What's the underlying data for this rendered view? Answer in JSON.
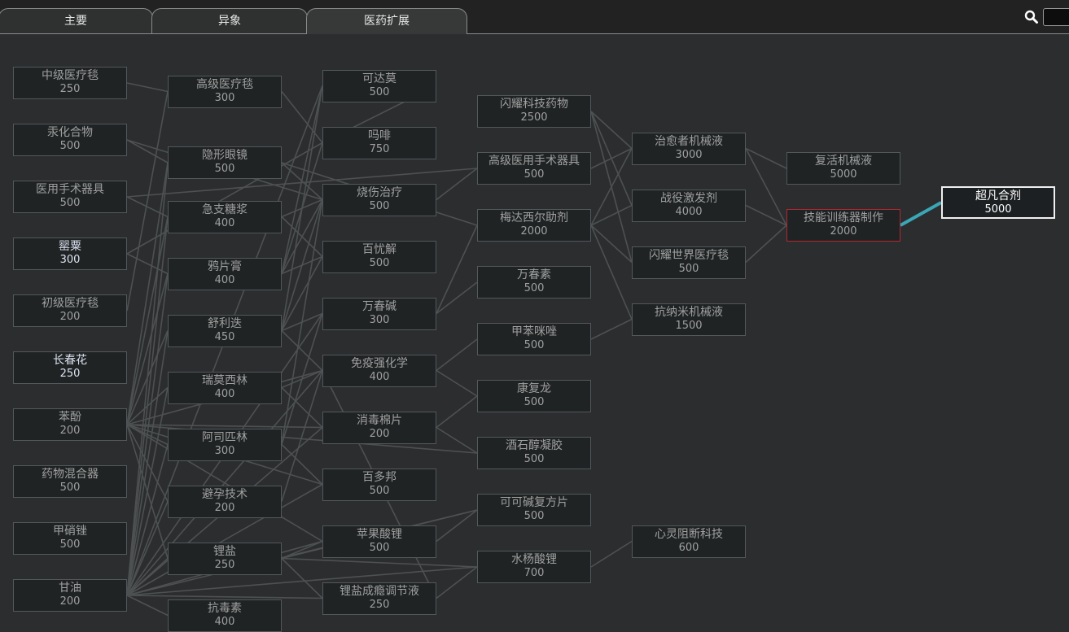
{
  "tabs": [
    {
      "label": "主要",
      "active": false
    },
    {
      "label": "异象",
      "active": false
    },
    {
      "label": "医药扩展",
      "active": true
    }
  ],
  "search": {
    "placeholder": ""
  },
  "colors": {
    "background": "#2b2d2e",
    "node_bg": "#1f2324",
    "node_border": "#53585b",
    "edge": "#4e5152",
    "selected_border": "#b42631",
    "highlight_link": "#3aa6b6",
    "researched_text": "#dde3f2"
  },
  "research": [
    {
      "id": "mid_blanket",
      "name": "中级医疗毯",
      "cost": "250",
      "col": 0,
      "row": 0
    },
    {
      "id": "mercury",
      "name": "汞化合物",
      "cost": "500",
      "col": 0,
      "row": 1
    },
    {
      "id": "surgical",
      "name": "医用手术器具",
      "cost": "500",
      "col": 0,
      "row": 2
    },
    {
      "id": "poppy",
      "name": "罂粟",
      "cost": "300",
      "col": 0,
      "row": 3,
      "state": "researched"
    },
    {
      "id": "basic_blanket",
      "name": "初级医疗毯",
      "cost": "200",
      "col": 0,
      "row": 4
    },
    {
      "id": "periwinkle",
      "name": "长春花",
      "cost": "250",
      "col": 0,
      "row": 5,
      "state": "researched"
    },
    {
      "id": "phenol",
      "name": "苯酚",
      "cost": "200",
      "col": 0,
      "row": 6
    },
    {
      "id": "mixer",
      "name": "药物混合器",
      "cost": "500",
      "col": 0,
      "row": 7
    },
    {
      "id": "nitrate",
      "name": "甲硝锉",
      "cost": "500",
      "col": 0,
      "row": 8
    },
    {
      "id": "glycerin",
      "name": "甘油",
      "cost": "200",
      "col": 0,
      "row": 9
    },
    {
      "id": "adv_blanket",
      "name": "高级医疗毯",
      "cost": "300",
      "col": 1,
      "row": 0.15
    },
    {
      "id": "lens",
      "name": "隐形眼镜",
      "cost": "500",
      "col": 1,
      "row": 1.4
    },
    {
      "id": "syrup",
      "name": "急支糖浆",
      "cost": "400",
      "col": 1,
      "row": 2.35
    },
    {
      "id": "opium",
      "name": "鸦片膏",
      "cost": "400",
      "col": 1,
      "row": 3.35
    },
    {
      "id": "sertraline",
      "name": "舒利迭",
      "cost": "450",
      "col": 1,
      "row": 4.35
    },
    {
      "id": "remdesivir",
      "name": "瑞莫西林",
      "cost": "400",
      "col": 1,
      "row": 5.35
    },
    {
      "id": "aspirin",
      "name": "阿司匹林",
      "cost": "300",
      "col": 1,
      "row": 6.35
    },
    {
      "id": "contra",
      "name": "避孕技术",
      "cost": "200",
      "col": 1,
      "row": 7.35
    },
    {
      "id": "lithium",
      "name": "锂盐",
      "cost": "250",
      "col": 1,
      "row": 8.35
    },
    {
      "id": "antitoxin",
      "name": "抗毒素",
      "cost": "400",
      "col": 1,
      "row": 9.35
    },
    {
      "id": "codeine",
      "name": "可达莫",
      "cost": "500",
      "col": 2,
      "row": 0.05
    },
    {
      "id": "morphine",
      "name": "吗啡",
      "cost": "750",
      "col": 2,
      "row": 1.05
    },
    {
      "id": "burn",
      "name": "烧伤治疗",
      "cost": "500",
      "col": 2,
      "row": 2.05
    },
    {
      "id": "prozac",
      "name": "百忧解",
      "cost": "500",
      "col": 2,
      "row": 3.05
    },
    {
      "id": "vinca",
      "name": "万春碱",
      "cost": "300",
      "col": 2,
      "row": 4.05
    },
    {
      "id": "immune",
      "name": "免疫强化学",
      "cost": "400",
      "col": 2,
      "row": 5.05
    },
    {
      "id": "disinfect",
      "name": "消毒棉片",
      "cost": "200",
      "col": 2,
      "row": 6.05
    },
    {
      "id": "bactroban",
      "name": "百多邦",
      "cost": "500",
      "col": 2,
      "row": 7.05
    },
    {
      "id": "malate",
      "name": "苹果酸锂",
      "cost": "500",
      "col": 2,
      "row": 8.05
    },
    {
      "id": "lithium_reg",
      "name": "锂盐成瘾调节液",
      "cost": "250",
      "col": 2,
      "row": 9.05
    },
    {
      "id": "glitter_med",
      "name": "闪耀科技药物",
      "cost": "2500",
      "col": 3,
      "row": 0.5
    },
    {
      "id": "adv_surgical",
      "name": "高级医用手术器具",
      "cost": "500",
      "col": 3,
      "row": 1.5
    },
    {
      "id": "medasol",
      "name": "梅达西尔助剂",
      "cost": "2000",
      "col": 3,
      "row": 2.5
    },
    {
      "id": "vincamine",
      "name": "万春素",
      "cost": "500",
      "col": 3,
      "row": 3.5
    },
    {
      "id": "mebendazole",
      "name": "甲苯咪唑",
      "cost": "500",
      "col": 3,
      "row": 4.5
    },
    {
      "id": "recovery",
      "name": "康复龙",
      "cost": "500",
      "col": 3,
      "row": 5.5
    },
    {
      "id": "gel",
      "name": "酒石醇凝胶",
      "cost": "500",
      "col": 3,
      "row": 6.5
    },
    {
      "id": "cocoa",
      "name": "可可碱复方片",
      "cost": "500",
      "col": 3,
      "row": 7.5
    },
    {
      "id": "salicylate",
      "name": "水杨酸锂",
      "cost": "700",
      "col": 3,
      "row": 8.5
    },
    {
      "id": "healer",
      "name": "治愈者机械液",
      "cost": "3000",
      "col": 4,
      "row": 1.15
    },
    {
      "id": "war_stim",
      "name": "战役激发剂",
      "cost": "4000",
      "col": 4,
      "row": 2.15
    },
    {
      "id": "glitter_blanket",
      "name": "闪耀世界医疗毯",
      "cost": "500",
      "col": 4,
      "row": 3.15
    },
    {
      "id": "nanite",
      "name": "抗纳米机械液",
      "cost": "1500",
      "col": 4,
      "row": 4.15
    },
    {
      "id": "psychic",
      "name": "心灵阻断科技",
      "cost": "600",
      "col": 4,
      "row": 8.05
    },
    {
      "id": "resurrect",
      "name": "复活机械液",
      "cost": "5000",
      "col": 5,
      "row": 1.5
    },
    {
      "id": "trainer",
      "name": "技能训练器制作",
      "cost": "2000",
      "col": 5,
      "row": 2.5,
      "state": "selected"
    },
    {
      "id": "super",
      "name": "超凡合剂",
      "cost": "5000",
      "col": 6,
      "row": 2.1,
      "state": "highlight"
    }
  ],
  "links": [
    [
      "mid_blanket",
      "adv_blanket"
    ],
    [
      "mercury",
      "lens"
    ],
    [
      "mercury",
      "burn"
    ],
    [
      "surgical",
      "adv_surgical"
    ],
    [
      "surgical",
      "syrup"
    ],
    [
      "poppy",
      "opium"
    ],
    [
      "poppy",
      "morphine"
    ],
    [
      "basic_blanket",
      "adv_blanket"
    ],
    [
      "phenol",
      "lens"
    ],
    [
      "phenol",
      "syrup"
    ],
    [
      "phenol",
      "opium"
    ],
    [
      "phenol",
      "sertraline"
    ],
    [
      "phenol",
      "remdesivir"
    ],
    [
      "phenol",
      "aspirin"
    ],
    [
      "phenol",
      "contra"
    ],
    [
      "phenol",
      "lithium"
    ],
    [
      "phenol",
      "disinfect"
    ],
    [
      "phenol",
      "gel"
    ],
    [
      "phenol",
      "immune"
    ],
    [
      "phenol",
      "bactroban"
    ],
    [
      "phenol",
      "malate"
    ],
    [
      "glycerin",
      "lens"
    ],
    [
      "glycerin",
      "syrup"
    ],
    [
      "glycerin",
      "opium"
    ],
    [
      "glycerin",
      "sertraline"
    ],
    [
      "glycerin",
      "remdesivir"
    ],
    [
      "glycerin",
      "aspirin"
    ],
    [
      "glycerin",
      "contra"
    ],
    [
      "glycerin",
      "lithium"
    ],
    [
      "glycerin",
      "antitoxin"
    ],
    [
      "glycerin",
      "disinfect"
    ],
    [
      "glycerin",
      "bactroban"
    ],
    [
      "glycerin",
      "malate"
    ],
    [
      "glycerin",
      "lithium_reg"
    ],
    [
      "glycerin",
      "salicylate"
    ],
    [
      "glycerin",
      "immune"
    ],
    [
      "glycerin",
      "vinca"
    ],
    [
      "glycerin",
      "codeine"
    ],
    [
      "glycerin",
      "cocoa"
    ],
    [
      "opium",
      "codeine"
    ],
    [
      "opium",
      "morphine"
    ],
    [
      "opium",
      "prozac"
    ],
    [
      "opium",
      "burn"
    ],
    [
      "sertraline",
      "prozac"
    ],
    [
      "sertraline",
      "vinca"
    ],
    [
      "sertraline",
      "immune"
    ],
    [
      "sertraline",
      "codeine"
    ],
    [
      "sertraline",
      "burn"
    ],
    [
      "remdesivir",
      "immune"
    ],
    [
      "remdesivir",
      "disinfect"
    ],
    [
      "aspirin",
      "vinca"
    ],
    [
      "aspirin",
      "burn"
    ],
    [
      "aspirin",
      "bactroban"
    ],
    [
      "lithium",
      "malate"
    ],
    [
      "lithium",
      "lithium_reg"
    ],
    [
      "lithium",
      "salicylate"
    ],
    [
      "lithium",
      "cocoa"
    ],
    [
      "contra",
      "immune"
    ],
    [
      "adv_blanket",
      "morphine"
    ],
    [
      "lens",
      "burn"
    ],
    [
      "lens",
      "medasol"
    ],
    [
      "syrup",
      "burn"
    ],
    [
      "syrup",
      "prozac"
    ],
    [
      "burn",
      "adv_surgical"
    ],
    [
      "vinca",
      "medasol"
    ],
    [
      "vinca",
      "vincamine"
    ],
    [
      "immune",
      "mebendazole"
    ],
    [
      "immune",
      "recovery"
    ],
    [
      "disinfect",
      "gel"
    ],
    [
      "disinfect",
      "recovery"
    ],
    [
      "malate",
      "cocoa"
    ],
    [
      "lithium_reg",
      "salicylate"
    ],
    [
      "lithium_reg",
      "immune"
    ],
    [
      "glitter_med",
      "healer"
    ],
    [
      "glitter_med",
      "war_stim"
    ],
    [
      "glitter_med",
      "glitter_blanket"
    ],
    [
      "medasol",
      "healer"
    ],
    [
      "medasol",
      "war_stim"
    ],
    [
      "medasol",
      "glitter_blanket"
    ],
    [
      "medasol",
      "nanite"
    ],
    [
      "adv_surgical",
      "healer"
    ],
    [
      "mebendazole",
      "nanite"
    ],
    [
      "salicylate",
      "psychic"
    ],
    [
      "healer",
      "resurrect"
    ],
    [
      "healer",
      "trainer"
    ],
    [
      "war_stim",
      "trainer"
    ],
    [
      "glitter_blanket",
      "trainer"
    ],
    [
      "codeine",
      "morphine"
    ]
  ],
  "highlight_links": [
    [
      "trainer",
      "super"
    ]
  ]
}
